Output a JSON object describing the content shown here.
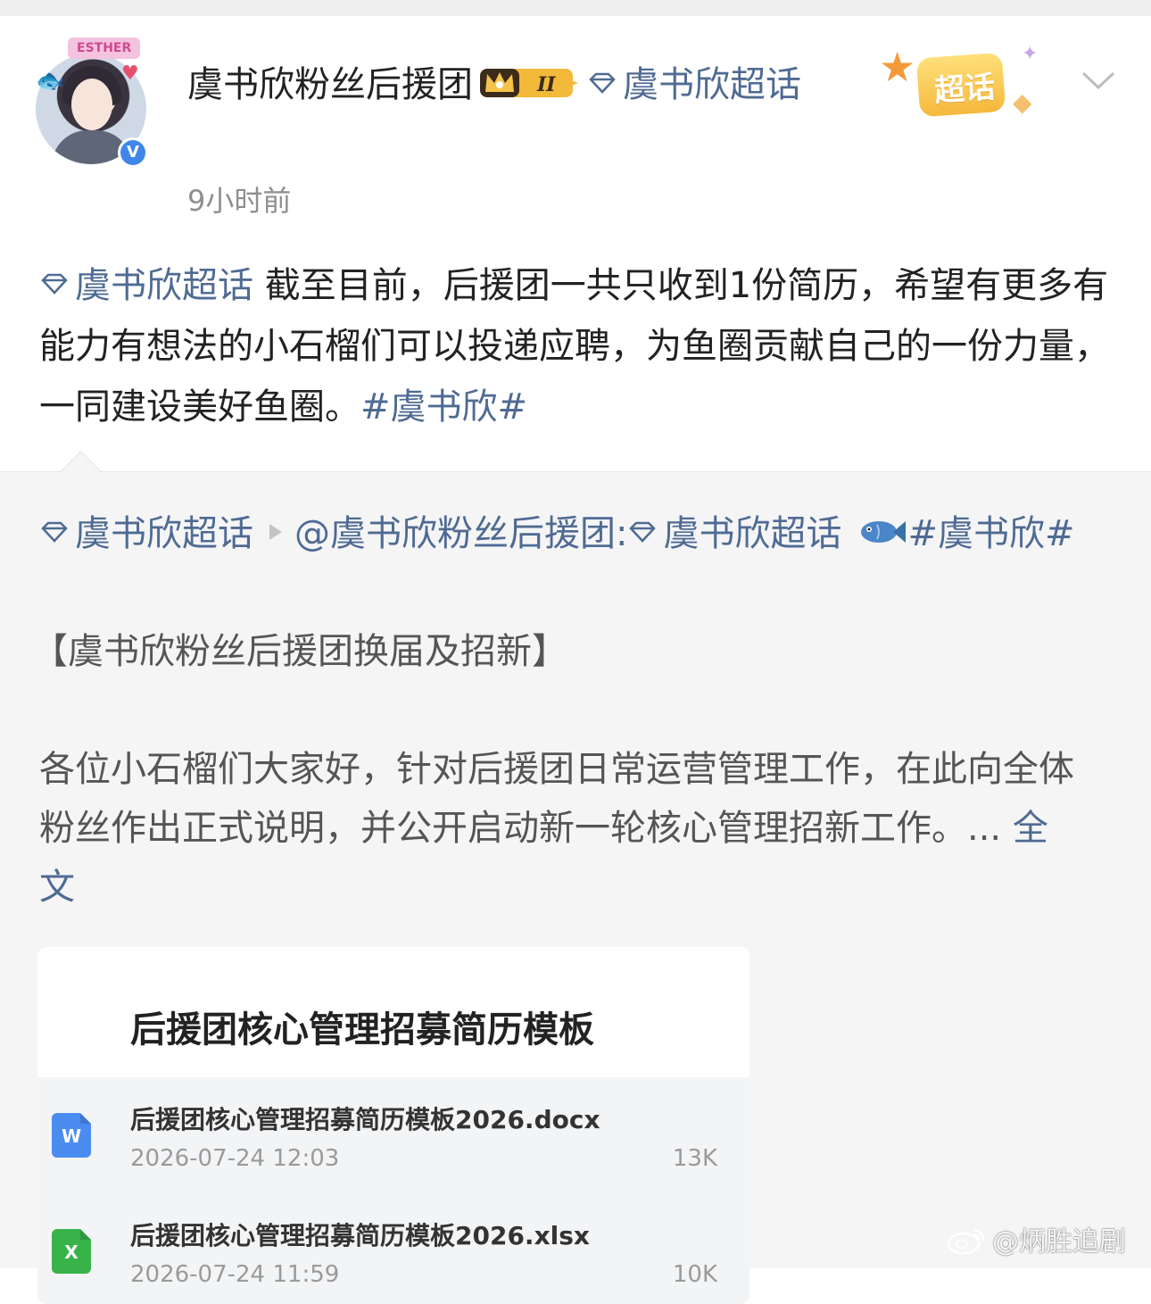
{
  "header": {
    "avatar_tag": "ESTHER",
    "author_name": "虞书欣粉丝后援团",
    "level_badge": "II",
    "supertopic_link": "虞书欣超话",
    "time": "9小时前",
    "supertopic_badge": "超话"
  },
  "post": {
    "topic_link": "虞书欣超话",
    "text": " 截至目前，后援团一共只收到1份简历，希望有更多有能力有想法的小石榴们可以投递应聘，为鱼圈贡献自己的一份力量，一同建设美好鱼圈。",
    "hashtag": "#虞书欣#"
  },
  "repost": {
    "topic_link": "虞书欣超话",
    "mention": "@虞书欣粉丝后援团:",
    "inner_topic": "虞书欣超话",
    "hashtag": "#虞书欣#",
    "title": "【虞书欣粉丝后援团换届及招新】",
    "body": "各位小石榴们大家好，针对后援团日常运营管理工作，在此向全体粉丝作出正式说明，并公开启动新一轮核心管理招新工作。...",
    "full_text_link": "全文"
  },
  "attachment_card": {
    "title": "后援团核心管理招募简历模板",
    "files": [
      {
        "name": "后援团核心管理招募简历模板2026.docx",
        "date": "2026-07-24 12:03",
        "size": "13K",
        "icon": "word-doc-icon",
        "color": "#4a8cf0"
      },
      {
        "name": "后援团核心管理招募简历模板2026.xlsx",
        "date": "2026-07-24 11:59",
        "size": "10K",
        "icon": "excel-sheet-icon",
        "color": "#37b34a"
      }
    ]
  },
  "watermark": "@炳胜追剧",
  "colors": {
    "link": "#4f6b93",
    "badge_gold": "#f5b83c",
    "verified_blue": "#3f86e8"
  }
}
